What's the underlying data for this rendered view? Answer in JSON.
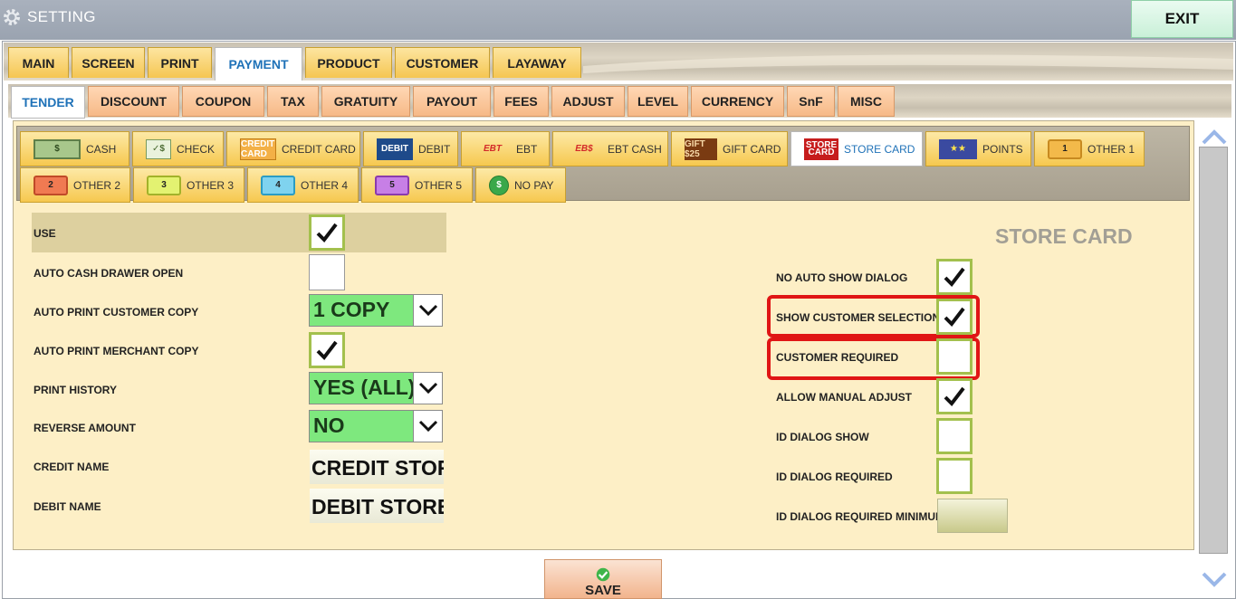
{
  "window": {
    "title": "SETTING",
    "exit_label": "EXIT"
  },
  "main_tabs": [
    "MAIN",
    "SCREEN",
    "PRINT",
    "PAYMENT",
    "PRODUCT",
    "CUSTOMER",
    "LAYAWAY"
  ],
  "main_tab_active": "PAYMENT",
  "sub_tabs": [
    "TENDER",
    "DISCOUNT",
    "COUPON",
    "TAX",
    "GRATUITY",
    "PAYOUT",
    "FEES",
    "ADJUST",
    "LEVEL",
    "CURRENCY",
    "SnF",
    "MISC"
  ],
  "sub_tab_active": "TENDER",
  "tender_tabs": {
    "cash": {
      "label": "CASH",
      "icon": "dollar-bill-icon",
      "icon_text": "$"
    },
    "check": {
      "label": "CHECK",
      "icon": "check-icon",
      "icon_text": "✓$"
    },
    "credit_card": {
      "label": "CREDIT CARD",
      "icon": "credit-card-icon",
      "icon_text": "CREDIT CARD"
    },
    "debit": {
      "label": "DEBIT",
      "icon": "debit-card-icon",
      "icon_text": "DEBIT"
    },
    "ebt": {
      "label": "EBT",
      "icon": "ebt-icon",
      "icon_text": "EBT"
    },
    "ebt_cash": {
      "label": "EBT CASH",
      "icon": "ebt-cash-icon",
      "icon_text": "EB$"
    },
    "gift_card": {
      "label": "GIFT CARD",
      "icon": "gift-card-icon",
      "icon_text": "GIFT $25"
    },
    "store_card": {
      "label": "STORE CARD",
      "icon": "store-card-icon",
      "icon_text": "STORE CARD"
    },
    "points": {
      "label": "POINTS",
      "icon": "stars-icon",
      "icon_text": "★★"
    },
    "other1": {
      "label": "OTHER 1",
      "icon": "other-1-icon",
      "icon_text": "1"
    },
    "other2": {
      "label": "OTHER 2",
      "icon": "other-2-icon",
      "icon_text": "2"
    },
    "other3": {
      "label": "OTHER 3",
      "icon": "other-3-icon",
      "icon_text": "3"
    },
    "other4": {
      "label": "OTHER 4",
      "icon": "other-4-icon",
      "icon_text": "4"
    },
    "other5": {
      "label": "OTHER 5",
      "icon": "other-5-icon",
      "icon_text": "5"
    },
    "no_pay": {
      "label": "NO PAY",
      "icon": "no-pay-icon",
      "icon_text": "$"
    }
  },
  "tender_tab_active": "STORE CARD",
  "left_settings": {
    "use": {
      "label": "USE",
      "checked": true
    },
    "auto_cash_drawer_open": {
      "label": "AUTO CASH DRAWER OPEN",
      "checked": false
    },
    "auto_print_customer_copy": {
      "label": "AUTO PRINT CUSTOMER COPY",
      "value": "1 COPY"
    },
    "auto_print_merchant_copy": {
      "label": "AUTO PRINT MERCHANT COPY",
      "checked": true
    },
    "print_history": {
      "label": "PRINT HISTORY",
      "value": "YES (ALL)"
    },
    "reverse_amount": {
      "label": "REVERSE AMOUNT",
      "value": "NO"
    },
    "credit_name": {
      "label": "CREDIT NAME",
      "value": "CREDIT STORE"
    },
    "debit_name": {
      "label": "DEBIT NAME",
      "value": "DEBIT STORE"
    }
  },
  "section_title": "STORE CARD",
  "right_settings": {
    "no_auto_show_dialog": {
      "label": "NO AUTO SHOW DIALOG",
      "checked": true
    },
    "show_customer_selection": {
      "label": "SHOW CUSTOMER SELECTION",
      "checked": true
    },
    "customer_required": {
      "label": "CUSTOMER REQUIRED",
      "checked": false
    },
    "allow_manual_adjust": {
      "label": "ALLOW MANUAL ADJUST",
      "checked": true
    },
    "id_dialog_show": {
      "label": "ID DIALOG SHOW",
      "checked": false
    },
    "id_dialog_required": {
      "label": "ID DIALOG REQUIRED",
      "checked": false
    },
    "id_dialog_required_minimum": {
      "label": "ID DIALOG REQUIRED MINIMUM",
      "value": ""
    }
  },
  "save_label": "SAVE",
  "colors": {
    "accent_blue": "#1f72b8",
    "highlight_red": "#e01515",
    "checkbox_green": "#a3c04d",
    "combo_green": "#7ee87e"
  }
}
